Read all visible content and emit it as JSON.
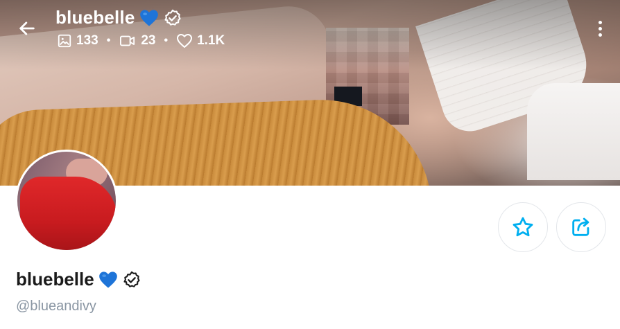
{
  "header": {
    "title": "bluebelle",
    "stats": {
      "photos": "133",
      "videos": "23",
      "likes": "1.1K",
      "separator": "•"
    }
  },
  "profile": {
    "display_name": "bluebelle",
    "handle": "@blueandivy"
  },
  "icons": {
    "back": "arrow-left-icon",
    "heart_emoji": "blue-heart-emoji",
    "verified": "verified-badge-icon",
    "photos": "image-icon",
    "videos": "video-camera-icon",
    "likes": "heart-outline-icon",
    "more": "more-vertical-icon",
    "favorite": "star-icon",
    "share": "share-icon"
  },
  "colors": {
    "accent": "#00aff0",
    "heart_blue": "#1e74d8",
    "handle_gray": "#8a96a3",
    "text_dark": "#1a1a1a"
  }
}
